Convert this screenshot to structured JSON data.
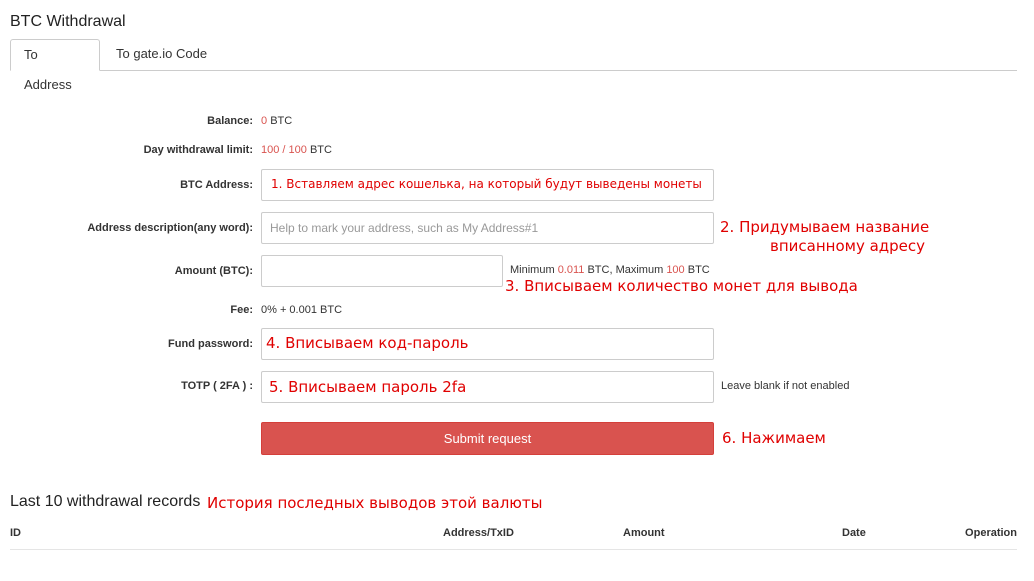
{
  "page": {
    "title": "BTC Withdrawal"
  },
  "tabs": [
    {
      "label": "To Address",
      "active": true
    },
    {
      "label": "To gate.io Code",
      "active": false
    }
  ],
  "form": {
    "balance": {
      "label": "Balance:",
      "value": "0",
      "unit": "BTC"
    },
    "day_limit": {
      "label": "Day withdrawal limit:",
      "used": "100",
      "separator": "/",
      "max": "100",
      "unit": "BTC"
    },
    "btc_address": {
      "label": "BTC Address:",
      "value": "",
      "overlay_text": "1. Вставляем адрес кошелька, на который будут выведены монеты"
    },
    "address_description": {
      "label": "Address description(any word):",
      "value": "",
      "placeholder": "Help to mark your address, such as My Address#1"
    },
    "amount": {
      "label": "Amount (BTC):",
      "value": "",
      "hint_min_label": "Minimum",
      "min": "0.011",
      "hint_mid": "BTC, Maximum",
      "max": "100",
      "hint_unit": "BTC"
    },
    "fee": {
      "label": "Fee:",
      "value": "0% + 0.001 BTC"
    },
    "fund_password": {
      "label": "Fund password:",
      "value": "",
      "overlay_text": "4. Вписываем код-пароль"
    },
    "totp": {
      "label": "TOTP ( 2FA ) :",
      "value": "",
      "overlay_text": "5. Вписываем пароль 2fa",
      "hint": "Leave blank if not enabled"
    },
    "submit_label": "Submit request"
  },
  "annotations": {
    "step2_line1": "2. Придумываем название",
    "step2_line2": "вписанному адресу",
    "step3": "3. Вписываем количество монет для вывода",
    "step6": "6. Нажимаем",
    "records": "История последных выводов этой валюты"
  },
  "records": {
    "title": "Last 10 withdrawal records",
    "columns": [
      "ID",
      "Address/TxID",
      "Amount",
      "Date",
      "Operation"
    ]
  },
  "colors": {
    "accent_red": "#d9534f",
    "annotation_red": "#e00000"
  }
}
